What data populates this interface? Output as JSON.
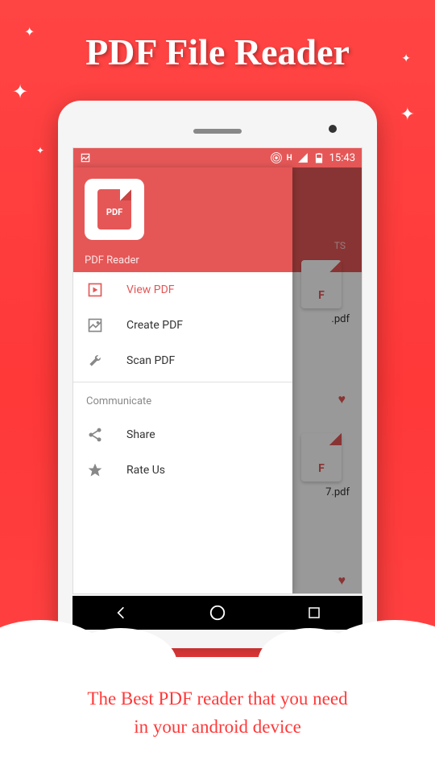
{
  "promo": {
    "title": "PDF File Reader",
    "tagline_line1": "The Best PDF reader that you need",
    "tagline_line2": "in your android device"
  },
  "statusbar": {
    "time": "15:43",
    "signal_label": "H"
  },
  "background_app": {
    "tab_label": "TS",
    "file1_suffix": ".pdf",
    "file2_suffix": "7.pdf",
    "doc_badge": "F"
  },
  "drawer": {
    "app_badge": "PDF",
    "title": "PDF Reader",
    "items": [
      {
        "label": "View PDF",
        "icon": "play-frame",
        "active": true
      },
      {
        "label": "Create PDF",
        "icon": "image",
        "active": false
      },
      {
        "label": "Scan PDF",
        "icon": "wrench",
        "active": false
      }
    ],
    "section_label": "Communicate",
    "comm_items": [
      {
        "label": "Share",
        "icon": "share"
      },
      {
        "label": "Rate Us",
        "icon": "star"
      }
    ]
  }
}
